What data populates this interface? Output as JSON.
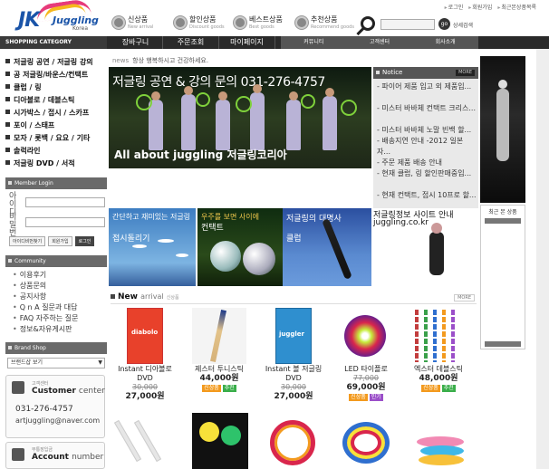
{
  "header": {
    "logo": {
      "jk": "JK",
      "juggling": "Juggling",
      "korea": "Korea"
    },
    "top_links": [
      "로그인",
      "회원가입",
      "최근본상품목록"
    ],
    "nav_icons": [
      {
        "label": "신상품",
        "sub": "New arrival"
      },
      {
        "label": "할인상품",
        "sub": "Discount goods"
      },
      {
        "label": "베스트상품",
        "sub": "Best goods"
      },
      {
        "label": "추천상품",
        "sub": "Recommend goods"
      }
    ],
    "search_placeholder": "",
    "go_label": "go",
    "detail_search": "상세검색"
  },
  "menubar": {
    "category_label": "SHOPPING CATEGORY",
    "main": [
      "장바구니",
      "주문조회",
      "마이페이지"
    ],
    "sub": [
      "커뮤니티",
      "고객센터",
      "회사소개"
    ]
  },
  "sidebar": {
    "categories": [
      "저글링 공연 / 저글링 강의",
      "공 저글링/바운스/컨택트",
      "클럽 / 링",
      "디아볼로 / 데블스틱",
      "시가박스 / 접시 / 스카프",
      "포이 / 스태프",
      "모자 / 롯백 / 요요 / 기타",
      "솔럭라인",
      "저글링 DVD / 서적"
    ],
    "login": {
      "title": "Member Login",
      "id_label": "아이디",
      "pw_label": "비밀번호",
      "buttons": [
        "아이디비번찾기",
        "회원가입",
        "로그인"
      ]
    },
    "community": {
      "title": "Community",
      "items": [
        "이용후기",
        "상품문의",
        "공지사항",
        "Q n A 질문과 대답",
        "FAQ 자주하는 질문",
        "정보&자유게시판"
      ]
    },
    "brand": {
      "title": "Brand Shop",
      "select": "브랜드샵 보기"
    },
    "customer": {
      "small": "고객센터",
      "title": "Customer",
      "title2": "center",
      "phone": "031-276-4757",
      "email": "artjuggling@naver.com"
    },
    "account": {
      "small": "무통장입금",
      "title": "Account",
      "title2": "number"
    }
  },
  "news": {
    "label": "news",
    "text": "항상 행복하시고 건강하세요."
  },
  "main_banner": {
    "title": "저글링 공연 & 강의 문의 031-276-4757",
    "subtitle": "All about juggling 저글링코리아"
  },
  "notice": {
    "title": "Notice",
    "more": "MORE",
    "items": [
      "- 파이어 제품 입고 외 제품입...",
      "- 미스터 바바체 컨택트 크리스...",
      "- 미스터 바바체 노말 빈백 할...",
      "- 배송지연 안내 -2012 일본자...",
      "- 주문 제품 배송 안내",
      "- 현재 클럽, 링 할인판매중입...",
      "- 현재 컨택트, 접시 10프로 할..."
    ]
  },
  "mini_banners": [
    {
      "t1": "간단하고 재미있는 저글링",
      "t2": "접시돌리기"
    },
    {
      "t1": "우주를 보면 사이에",
      "t2": "컨택트"
    },
    {
      "t1": "저글링의 대명사",
      "t2": "클럽"
    }
  ],
  "info_banner": {
    "t1": "저글링정보 사이트 안내",
    "t2": "juggling.co.kr"
  },
  "new_arrival": {
    "title": "New",
    "title2": "arrival",
    "title3": "신상품",
    "more": "MORE"
  },
  "products": [
    {
      "name": "Instant 디아볼로 DVD",
      "old": "30,000",
      "price": "27,000원",
      "badges": [],
      "color": "#e8412b"
    },
    {
      "name": "제스터 투니스틱",
      "old": "",
      "price": "44,000원",
      "badges": [
        "신상품",
        "추천"
      ],
      "color": "#d7c3a0"
    },
    {
      "name": "Instant 볼 저글링 DVD",
      "old": "30,000",
      "price": "27,000원",
      "badges": [],
      "color": "#2f8fcf"
    },
    {
      "name": "LED 타이플로",
      "old": "77,000",
      "price": "69,000원",
      "badges": [
        "신상품",
        "인기"
      ],
      "color": "#d9264c"
    },
    {
      "name": "엑스터 데블스틱",
      "old": "",
      "price": "48,000원",
      "badges": [
        "신상품",
        "추천"
      ],
      "color": "#c23d3d"
    }
  ],
  "recent": {
    "title": "최근 본 상품"
  }
}
